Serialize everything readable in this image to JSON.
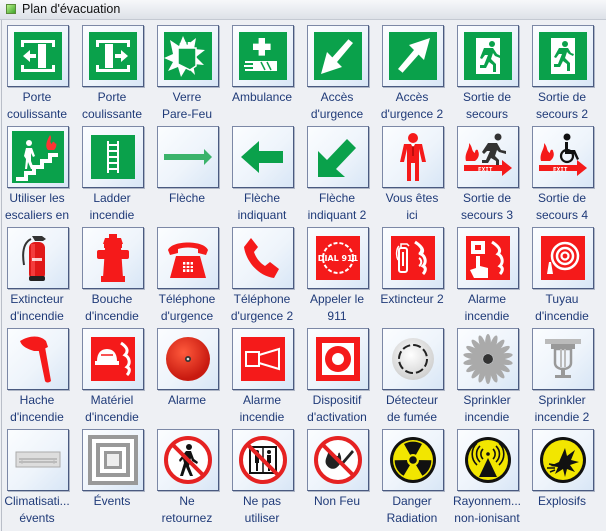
{
  "window": {
    "title": "Plan d'évacuation",
    "title_icon": "stencil-icon"
  },
  "colors": {
    "safe_green": "#0aa14b",
    "fire_red": "#f51a1a",
    "warn_yellow": "#f2e600",
    "label_blue": "#1f3a78"
  },
  "shapes": [
    {
      "icon": "sliding-door-left-icon",
      "line1": "Porte",
      "line2": "coulissante"
    },
    {
      "icon": "sliding-door-right-icon",
      "line1": "Porte",
      "line2": "coulissante"
    },
    {
      "icon": "break-glass-icon",
      "line1": "Verre",
      "line2": "Pare-Feu"
    },
    {
      "icon": "first-aid-icon",
      "line1": "Ambulance",
      "line2": ""
    },
    {
      "icon": "arrow-down-left-icon",
      "line1": "Accès",
      "line2": "d'urgence"
    },
    {
      "icon": "arrow-up-right-icon",
      "line1": "Accès",
      "line2": "d'urgence 2"
    },
    {
      "icon": "exit-running-man-icon",
      "line1": "Sortie de",
      "line2": "secours"
    },
    {
      "icon": "exit-running-man-left-icon",
      "line1": "Sortie de",
      "line2": "secours 2"
    },
    {
      "icon": "stairs-fire-icon",
      "line1": "Utiliser les",
      "line2": "escaliers en"
    },
    {
      "icon": "ladder-icon",
      "line1": "Ladder",
      "line2": "incendie"
    },
    {
      "icon": "arrow-right-icon",
      "line1": "Flèche",
      "line2": ""
    },
    {
      "icon": "arrow-left-icon",
      "line1": "Flèche",
      "line2": "indiquant"
    },
    {
      "icon": "arrow-diagonal-icon",
      "line1": "Flèche",
      "line2": "indiquant 2"
    },
    {
      "icon": "you-are-here-icon",
      "line1": "Vous êtes",
      "line2": "ici"
    },
    {
      "icon": "fire-exit-person-icon",
      "line1": "Sortie de",
      "line2": "secours 3",
      "exit_text": "Exit"
    },
    {
      "icon": "fire-exit-wheelchair-icon",
      "line1": "Sortie de",
      "line2": "secours 4",
      "exit_text": "Exit"
    },
    {
      "icon": "fire-extinguisher-icon",
      "line1": "Extincteur",
      "line2": "d'incendie"
    },
    {
      "icon": "fire-hydrant-icon",
      "line1": "Bouche",
      "line2": "d'incendie"
    },
    {
      "icon": "telephone-icon",
      "line1": "Téléphone",
      "line2": "d'urgence"
    },
    {
      "icon": "phone-handset-icon",
      "line1": "Téléphone",
      "line2": "d'urgence 2"
    },
    {
      "icon": "dial-911-icon",
      "line1": "Appeler le",
      "line2": "911",
      "dial_text": "DIAL 911"
    },
    {
      "icon": "extinguisher-sign-icon",
      "line1": "Extincteur 2",
      "line2": ""
    },
    {
      "icon": "fire-alarm-button-icon",
      "line1": "Alarme",
      "line2": "incendie"
    },
    {
      "icon": "fire-hose-icon",
      "line1": "Tuyau",
      "line2": "d'incendie"
    },
    {
      "icon": "fire-axe-icon",
      "line1": "Hache",
      "line2": "d'incendie"
    },
    {
      "icon": "fire-equipment-icon",
      "line1": "Matériel",
      "line2": "d'incendie"
    },
    {
      "icon": "alarm-bell-icon",
      "line1": "Alarme",
      "line2": ""
    },
    {
      "icon": "fire-siren-icon",
      "line1": "Alarme",
      "line2": "incendie"
    },
    {
      "icon": "activation-device-icon",
      "line1": "Dispositif",
      "line2": "d'activation"
    },
    {
      "icon": "smoke-detector-icon",
      "line1": "Détecteur",
      "line2": "de fumée"
    },
    {
      "icon": "sprinkler-icon",
      "line1": "Sprinkler",
      "line2": "incendie"
    },
    {
      "icon": "sprinkler-head-icon",
      "line1": "Sprinkler",
      "line2": "incendie 2"
    },
    {
      "icon": "air-vent-icon",
      "line1": "Climatisati...",
      "line2": "évents"
    },
    {
      "icon": "vents-icon",
      "line1": "Évents",
      "line2": ""
    },
    {
      "icon": "no-return-icon",
      "line1": "Ne",
      "line2": "retournez"
    },
    {
      "icon": "no-elevator-icon",
      "line1": "Ne pas",
      "line2": "utiliser"
    },
    {
      "icon": "no-fire-icon",
      "line1": "Non Feu",
      "line2": ""
    },
    {
      "icon": "radiation-icon",
      "line1": "Danger",
      "line2": "Radiation"
    },
    {
      "icon": "non-ionizing-radiation-icon",
      "line1": "Rayonnem...",
      "line2": "non-ionisant"
    },
    {
      "icon": "explosive-icon",
      "line1": "Explosifs",
      "line2": ""
    }
  ]
}
